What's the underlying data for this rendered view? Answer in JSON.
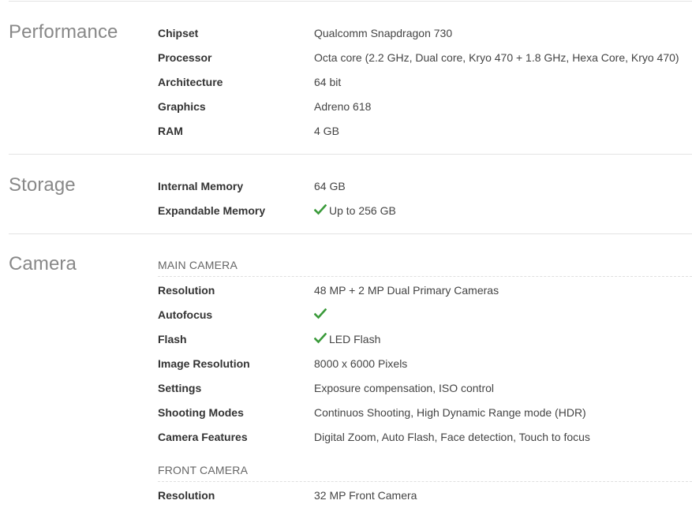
{
  "performance": {
    "title": "Performance",
    "rows": [
      {
        "label": "Chipset",
        "value": "Qualcomm Snapdragon 730"
      },
      {
        "label": "Processor",
        "value": "Octa core (2.2 GHz, Dual core, Kryo 470 + 1.8 GHz, Hexa Core, Kryo 470)"
      },
      {
        "label": "Architecture",
        "value": "64 bit"
      },
      {
        "label": "Graphics",
        "value": "Adreno 618"
      },
      {
        "label": "RAM",
        "value": "4 GB"
      }
    ]
  },
  "storage": {
    "title": "Storage",
    "rows": [
      {
        "label": "Internal Memory",
        "value": "64 GB"
      },
      {
        "label": "Expandable Memory",
        "value": "Up to 256 GB",
        "check": true
      }
    ]
  },
  "camera": {
    "title": "Camera",
    "main_heading": "MAIN CAMERA",
    "main_rows": [
      {
        "label": "Resolution",
        "value": "48 MP + 2 MP Dual Primary Cameras"
      },
      {
        "label": "Autofocus",
        "value": "",
        "check": true
      },
      {
        "label": "Flash",
        "value": "LED Flash",
        "check": true
      },
      {
        "label": "Image Resolution",
        "value": "8000 x 6000 Pixels"
      },
      {
        "label": "Settings",
        "value": "Exposure compensation, ISO control"
      },
      {
        "label": "Shooting Modes",
        "value": "Continuos Shooting, High Dynamic Range mode (HDR)"
      },
      {
        "label": "Camera Features",
        "value": "Digital Zoom, Auto Flash, Face detection, Touch to focus"
      }
    ],
    "front_heading": "FRONT CAMERA",
    "front_rows": [
      {
        "label": "Resolution",
        "value": "32 MP Front Camera"
      }
    ]
  },
  "colors": {
    "check": "#3a9a3a",
    "section_title": "#888888",
    "rule": "#e3e3e3"
  },
  "icons": {
    "check": "check-icon"
  }
}
